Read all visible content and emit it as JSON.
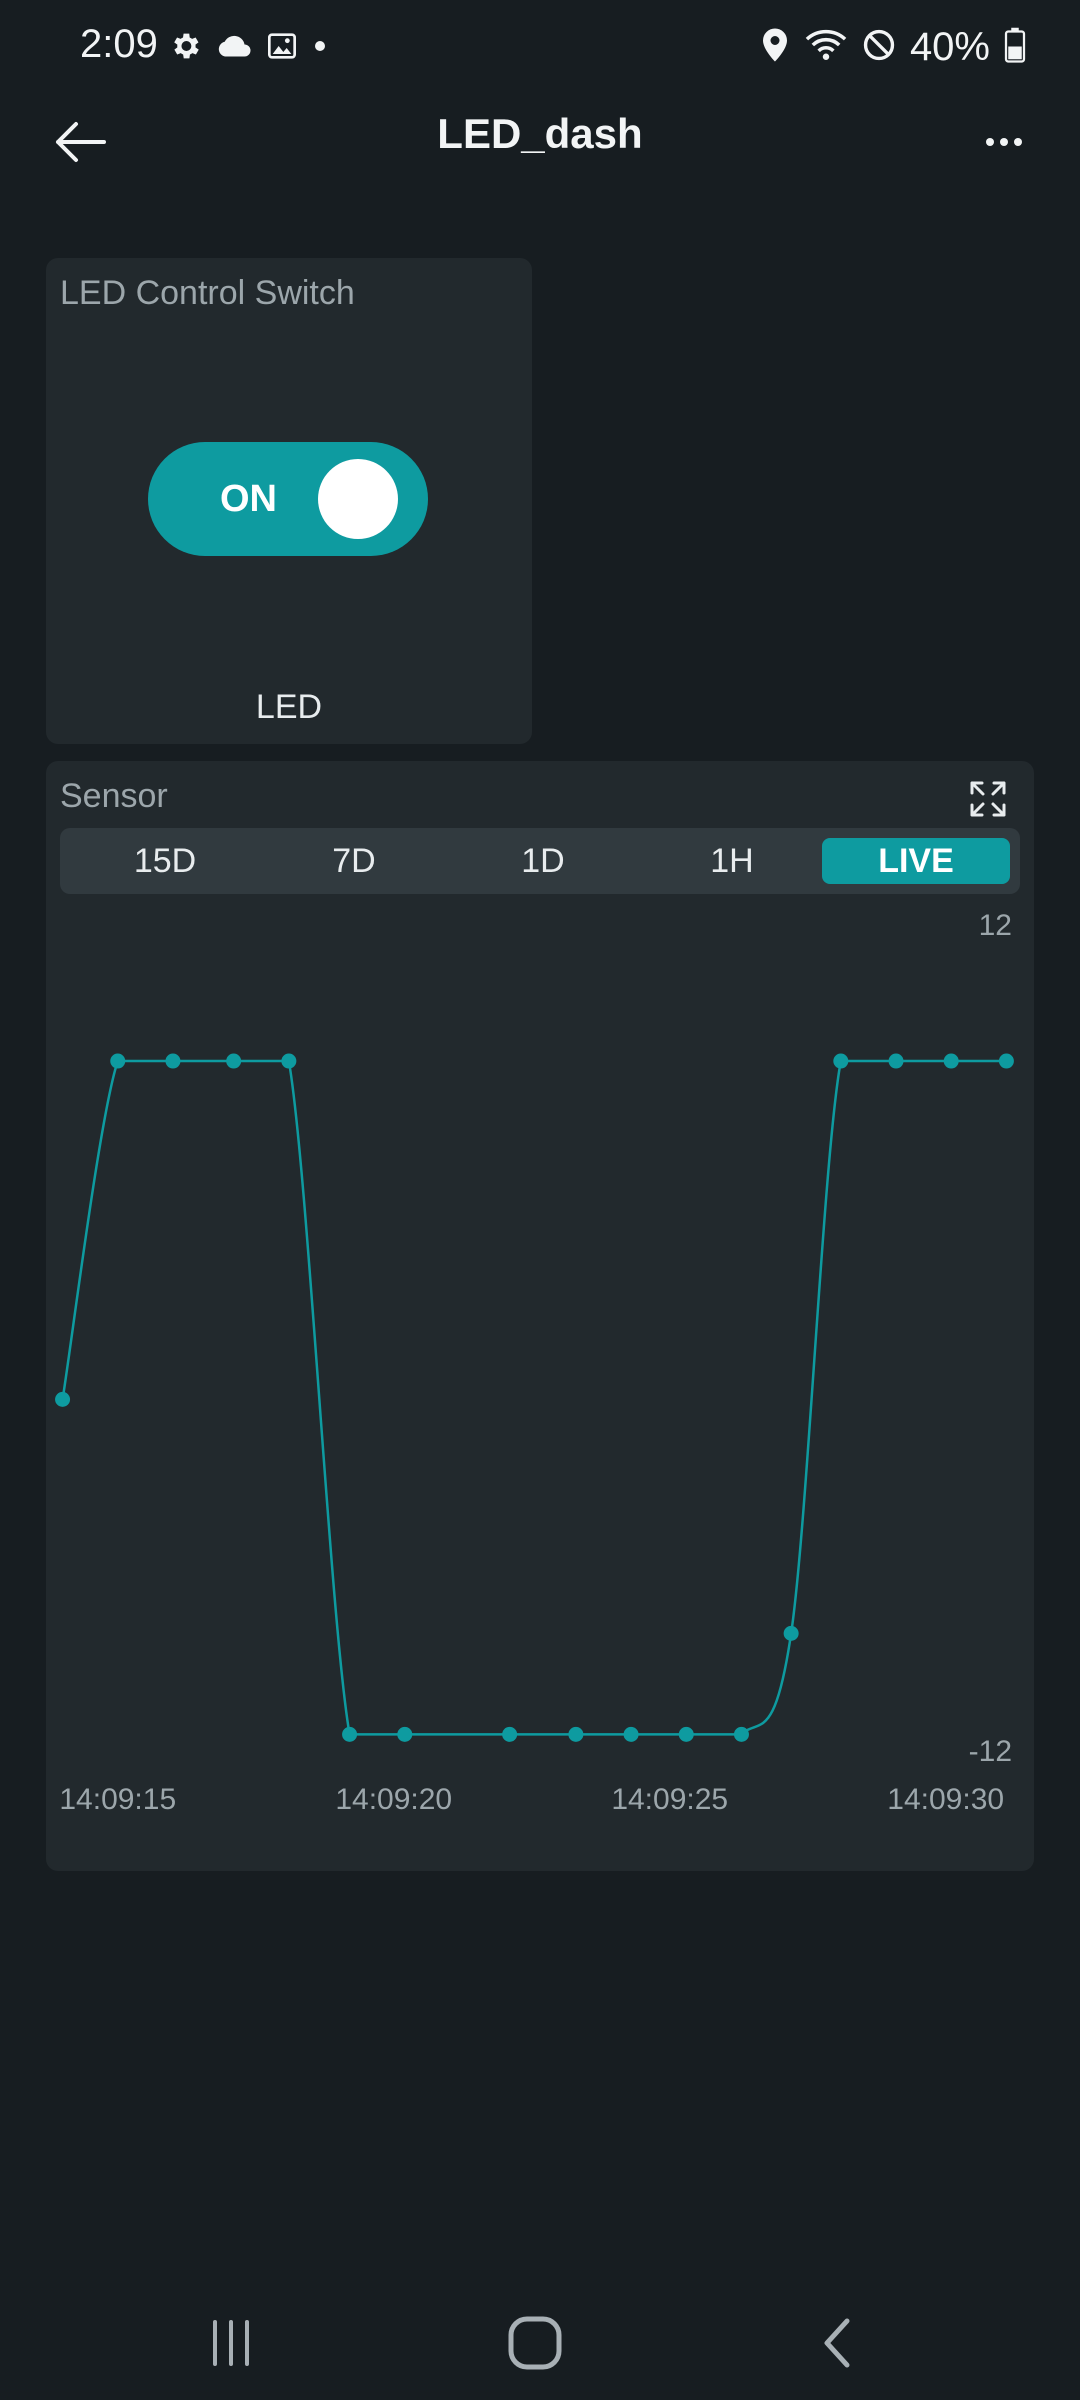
{
  "status_bar": {
    "time": "2:09",
    "icons_left": [
      "settings-gear",
      "cloud",
      "gallery-image",
      "dot"
    ],
    "icons_right": [
      "location-pin",
      "wifi",
      "do-not-disturb"
    ],
    "battery": "40%"
  },
  "app_bar": {
    "title": "LED_dash",
    "back_icon": "arrow-left",
    "more_icon": "more-horizontal"
  },
  "switch_widget": {
    "title": "LED Control Switch",
    "state_label": "ON",
    "variable": "LED",
    "accent": "#0e9ba0"
  },
  "chart_widget": {
    "title": "Sensor",
    "expand_icon": "expand-arrows",
    "ranges": [
      "15D",
      "7D",
      "1D",
      "1H",
      "LIVE"
    ],
    "active_range": "LIVE"
  },
  "chart_data": {
    "type": "line",
    "title": "",
    "xlabel": "",
    "ylabel": "",
    "ylim": [
      -12,
      12
    ],
    "y_axis_labels": [
      "12",
      "-12"
    ],
    "x_tick_labels": [
      "14:09:15",
      "14:09:20",
      "14:09:25",
      "14:09:30"
    ],
    "x_ticks": [
      15,
      20,
      25,
      30
    ],
    "xlim": [
      13.7,
      31.6
    ],
    "grid": false,
    "color": "#0e9ba0",
    "series": [
      {
        "x": [
          14.0,
          15.0,
          16.0,
          17.1,
          18.1,
          19.2,
          20.2,
          22.1,
          23.3,
          24.3,
          25.3,
          26.3,
          27.2,
          28.1,
          29.1,
          30.1,
          31.1
        ],
        "values": [
          -0.05,
          10.0,
          10.0,
          10.0,
          10.0,
          -10.0,
          -10.0,
          -10.0,
          -10.0,
          -10.0,
          -10.0,
          -10.0,
          -7.0,
          10.0,
          10.0,
          10.0,
          10.0
        ]
      }
    ]
  },
  "nav_bar": {
    "icons": [
      "recent-apps",
      "home",
      "back"
    ]
  }
}
